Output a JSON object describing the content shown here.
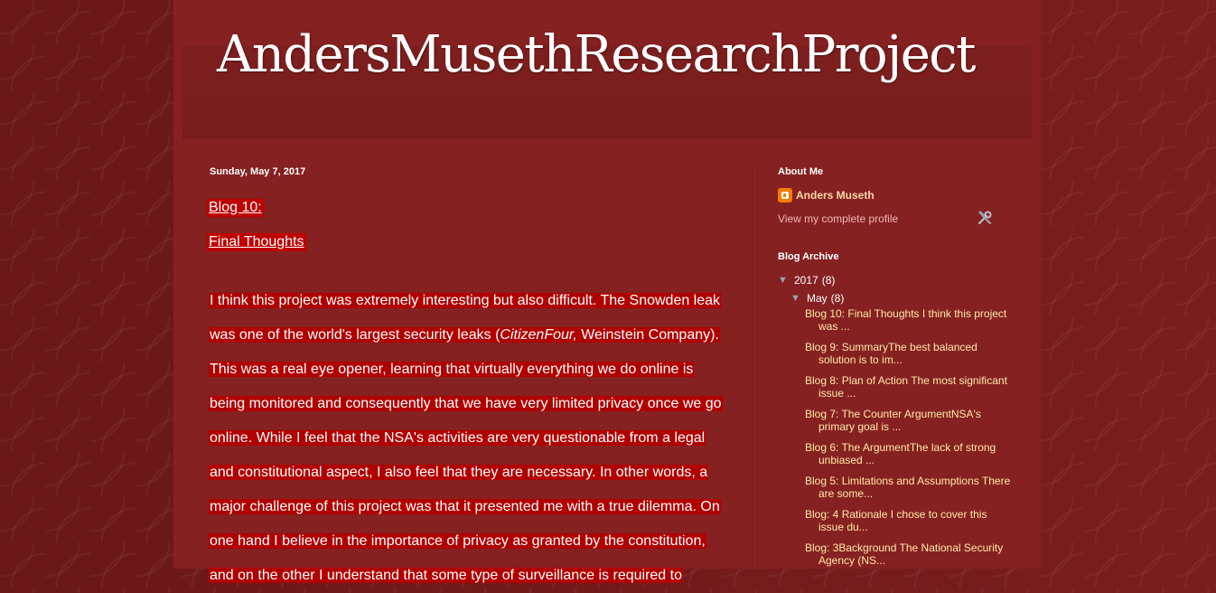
{
  "blog": {
    "title": "AndersMusethResearchProject"
  },
  "post": {
    "date": "Sunday, May 7, 2017",
    "title_line1": "Blog 10: ",
    "title_line2": "Final Thoughts",
    "lines": [
      " I think this project was extremely interesting but also difficult. The Snowden leak",
      "was one of the world's largest security leaks (",
      "This was a real eye opener, learning that virtually everything we do online is",
      "being monitored and consequently that we have very limited privacy once we go",
      "online. While I feel that the NSA's activities are very questionable from a legal",
      "and constitutional aspect, I also feel that they are necessary. In other words, a",
      "major challenge of this project was that it presented me with a true dilemma. On",
      "one hand I believe in the importance of privacy as granted by the constitution,",
      "and on the other I understand that some type of surveillance is required to"
    ],
    "citation_italic": "CitizenFour,",
    "citation_rest": " Weinstein Company)."
  },
  "sidebar": {
    "about_title": "About Me",
    "profile_name": "Anders Museth",
    "profile_link": "View my complete profile",
    "archive_title": "Blog Archive",
    "year": "2017",
    "year_count": "(8)",
    "month": "May",
    "month_count": "(8)",
    "posts": [
      "Blog 10: Final Thoughts I think this project was ...",
      "Blog 9: SummaryThe best balanced solution is to im...",
      "Blog 8: Plan of Action The most significant issue ...",
      "Blog 7: The Counter ArgumentNSA's primary goal is ...",
      "Blog 6: The ArgumentThe lack of strong unbiased ...",
      "Blog 5: Limitations and Assumptions There are some...",
      "Blog: 4 Rationale I chose to cover this issue du...",
      "Blog: 3Background The National Security Agency (NS..."
    ]
  },
  "colors": {
    "background": "#5e1616",
    "content": "#862121",
    "highlight": "#b00000",
    "link": "#ffe9a8"
  }
}
